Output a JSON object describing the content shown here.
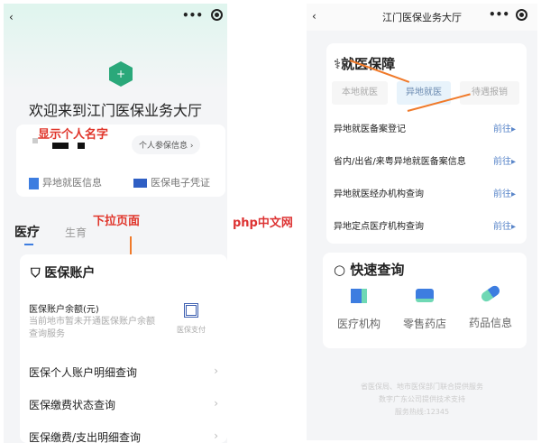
{
  "left": {
    "title": "欢迎来到江门医保业务大厅",
    "annotation_name": "显示个人名字",
    "insured_info_button": "个人参保信息",
    "shortcuts": [
      {
        "label": "异地就医信息",
        "icon": "document-icon"
      },
      {
        "label": "医保电子凭证",
        "icon": "id-card-icon"
      }
    ],
    "tabs": [
      "医疗",
      "生育"
    ],
    "annotation_scroll": "下拉页面",
    "section_title": "医保账户",
    "balance_label": "医保账户余额(元)",
    "balance_note": "当前地市暂未开通医保账户余额查询服务",
    "pay_label": "医保支付",
    "menu": [
      "医保个人账户明细查询",
      "医保缴费状态查询",
      "医保缴费/支出明细查询"
    ]
  },
  "right": {
    "nav_title": "江门医保业务大厅",
    "section_title": "就医保障",
    "tabs": [
      "本地就医",
      "异地就医",
      "待遇报销"
    ],
    "go_label": "前往",
    "rows": [
      "异地就医备案登记",
      "省内/出省/来粤异地就医备案信息",
      "异地就医经办机构查询",
      "异地定点医疗机构查询"
    ],
    "quick_title": "快速查询",
    "quick_items": [
      {
        "label": "医疗机构",
        "icon": "hospital-icon"
      },
      {
        "label": "零售药店",
        "icon": "pharmacy-icon"
      },
      {
        "label": "药品信息",
        "icon": "pill-icon"
      }
    ],
    "footer": [
      "省医保局、地市医保部门联合提供服务",
      "数字广东公司提供技术支持",
      "服务热线:12345"
    ]
  },
  "watermark": "php中文网",
  "colors": {
    "accent": "#2aa87a",
    "annotation": "#e0352b",
    "arrow": "#f07a2a",
    "link": "#5a86c9"
  }
}
